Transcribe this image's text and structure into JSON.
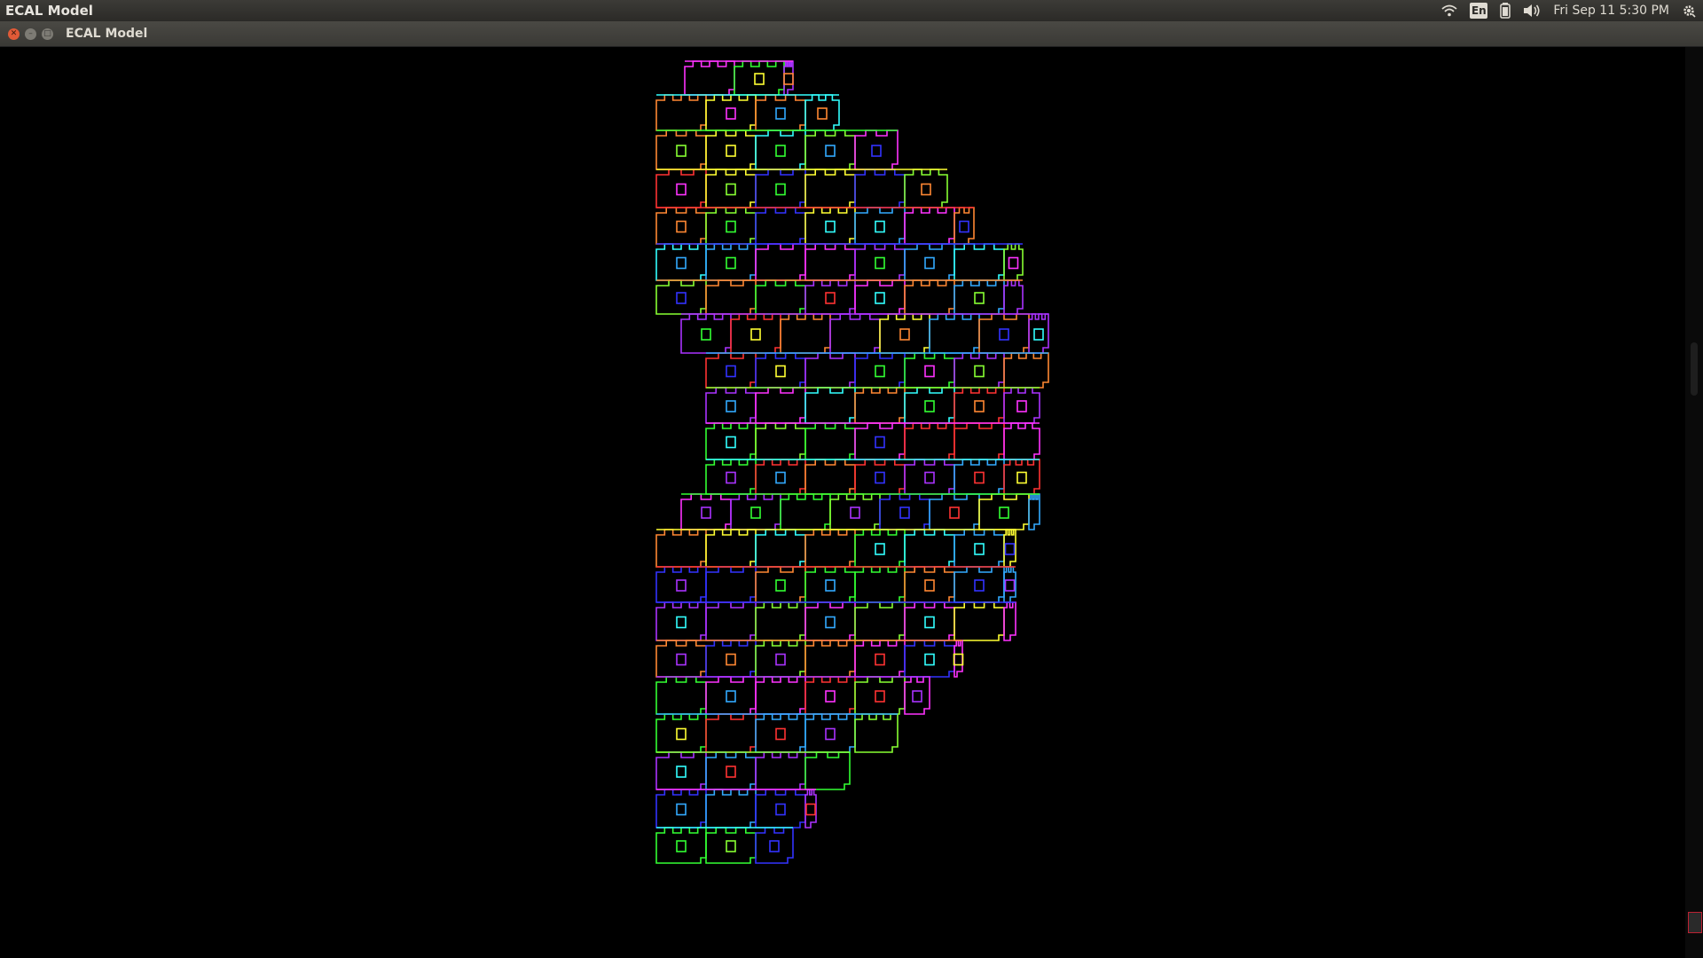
{
  "panel": {
    "app_title": "ECAL Model",
    "lang": "En",
    "clock": "Fri Sep 11  5:30 PM",
    "icons": [
      "wifi-icon",
      "keyboard-lang-icon",
      "battery-icon",
      "volume-icon",
      "gear-icon"
    ]
  },
  "window": {
    "title": "ECAL Model",
    "buttons": [
      "close",
      "minimize",
      "maximize"
    ]
  },
  "colors": {
    "background": "#000000",
    "palette": [
      "#ff33ff",
      "#33ffff",
      "#33ff33",
      "#ffff33",
      "#ff3333",
      "#3333ff",
      "#ff8833",
      "#aa33ff",
      "#33aaff",
      "#88ff33"
    ]
  }
}
